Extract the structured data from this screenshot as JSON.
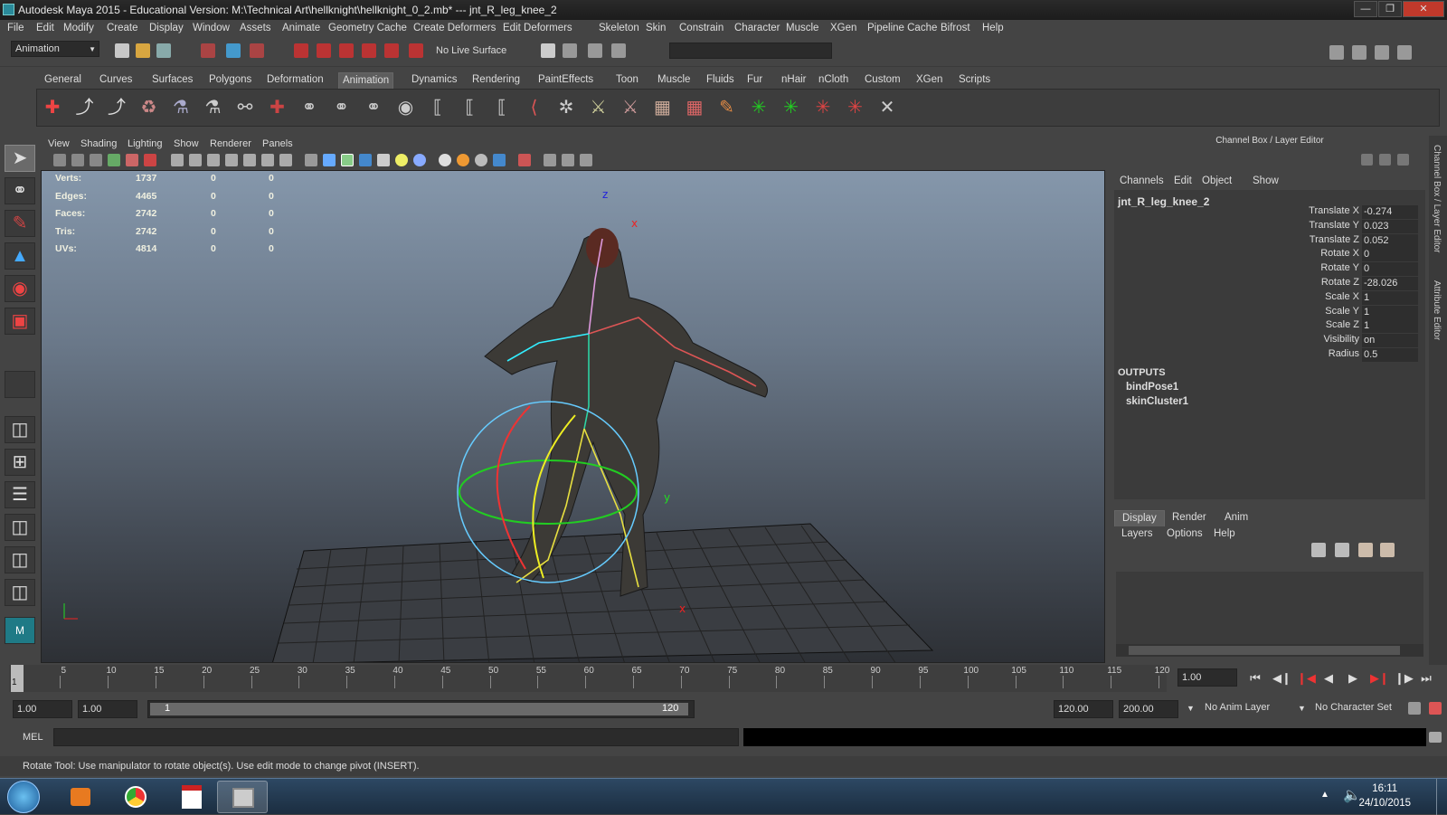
{
  "window": {
    "title": "Autodesk Maya 2015 - Educational Version: M:\\Technical Art\\hellknight\\hellknight_0_2.mb*   ---   jnt_R_leg_knee_2"
  },
  "menubar": [
    "File",
    "Edit",
    "Modify",
    "Create",
    "Display",
    "Window",
    "Assets",
    "Animate",
    "Geometry Cache",
    "Create Deformers",
    "Edit Deformers",
    "Skeleton",
    "Skin",
    "Constrain",
    "Character",
    "Muscle",
    "XGen",
    "Pipeline Cache",
    "Bifrost",
    "Help"
  ],
  "statusline": {
    "menuset": "Animation",
    "live_surface": "No Live Surface"
  },
  "shelf_tabs": [
    "General",
    "Curves",
    "Surfaces",
    "Polygons",
    "Deformation",
    "Animation",
    "Dynamics",
    "Rendering",
    "PaintEffects",
    "Toon",
    "Muscle",
    "Fluids",
    "Fur",
    "nHair",
    "nCloth",
    "Custom",
    "XGen",
    "Scripts"
  ],
  "shelf_active": "Animation",
  "panel_menu": [
    "View",
    "Shading",
    "Lighting",
    "Show",
    "Renderer",
    "Panels"
  ],
  "hud": {
    "rows": [
      {
        "label": "Verts:",
        "v1": "1737",
        "v2": "0",
        "v3": "0"
      },
      {
        "label": "Edges:",
        "v1": "4465",
        "v2": "0",
        "v3": "0"
      },
      {
        "label": "Faces:",
        "v1": "2742",
        "v2": "0",
        "v3": "0"
      },
      {
        "label": "Tris:",
        "v1": "2742",
        "v2": "0",
        "v3": "0"
      },
      {
        "label": "UVs:",
        "v1": "4814",
        "v2": "0",
        "v3": "0"
      }
    ]
  },
  "channel_box": {
    "title": "Channel Box / Layer Editor",
    "menu": [
      "Channels",
      "Edit",
      "Object",
      "Show"
    ],
    "node": "jnt_R_leg_knee_2",
    "channels": [
      {
        "label": "Translate X",
        "value": "-0.274"
      },
      {
        "label": "Translate Y",
        "value": "0.023"
      },
      {
        "label": "Translate Z",
        "value": "0.052"
      },
      {
        "label": "Rotate X",
        "value": "0"
      },
      {
        "label": "Rotate Y",
        "value": "0"
      },
      {
        "label": "Rotate Z",
        "value": "-28.026"
      },
      {
        "label": "Scale X",
        "value": "1"
      },
      {
        "label": "Scale Y",
        "value": "1"
      },
      {
        "label": "Scale Z",
        "value": "1"
      },
      {
        "label": "Visibility",
        "value": "on"
      },
      {
        "label": "Radius",
        "value": "0.5"
      }
    ],
    "outputs_header": "OUTPUTS",
    "outputs": [
      "bindPose1",
      "skinCluster1"
    ]
  },
  "side_tabs": [
    "Channel Box / Layer Editor",
    "Attribute Editor"
  ],
  "layer_editor": {
    "tabs": [
      "Display",
      "Render",
      "Anim"
    ],
    "active_tab": "Display",
    "menu": [
      "Layers",
      "Options",
      "Help"
    ]
  },
  "timeline": {
    "ticks": [
      "5",
      "10",
      "15",
      "20",
      "25",
      "30",
      "35",
      "40",
      "45",
      "50",
      "55",
      "60",
      "65",
      "70",
      "75",
      "80",
      "85",
      "90",
      "95",
      "100",
      "105",
      "110",
      "115",
      "120"
    ],
    "current_frame": "1",
    "current_time_field": "1.00"
  },
  "range": {
    "start": "1.00",
    "playback_start": "1.00",
    "range_start_label": "1",
    "range_end_label": "120",
    "playback_end": "120.00",
    "end": "200.00",
    "anim_layer": "No Anim Layer",
    "character_set": "No Character Set"
  },
  "command": {
    "label": "MEL"
  },
  "help_line": "Rotate Tool: Use manipulator to rotate object(s). Use edit mode to change pivot (INSERT).",
  "taskbar": {
    "time": "16:11",
    "date": "24/10/2015"
  },
  "colors": {
    "maya_bg": "#444444",
    "viewport_top": "#8597ab",
    "viewport_bottom": "#2d3035",
    "shelf_active": "#5d5d5d"
  }
}
